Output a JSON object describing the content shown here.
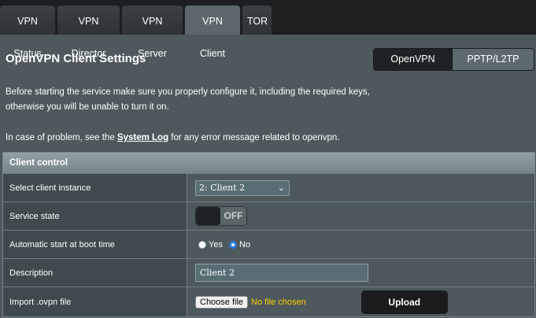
{
  "tabs": [
    {
      "label": "VPN Status"
    },
    {
      "label": "VPN Director"
    },
    {
      "label": "VPN Server"
    },
    {
      "label": "VPN Client",
      "active": true
    },
    {
      "label": "TOR"
    }
  ],
  "header": {
    "title": "OpenVPN Client Settings",
    "mode_options": [
      "OpenVPN",
      "PPTP/L2TP"
    ],
    "mode_selected": "OpenVPN"
  },
  "notes": {
    "line1": "Before starting the service make sure you properly configure it, including the required keys,",
    "line2": "otherwise you will be unable to turn it on.",
    "problem_prefix": "In case of problem, see the ",
    "system_log_link": "System Log",
    "problem_suffix": " for any error message related to openvpn."
  },
  "client_control": {
    "section_title": "Client control",
    "rows": {
      "instance": {
        "label": "Select client instance",
        "value": "2: Client 2"
      },
      "service_state": {
        "label": "Service state",
        "toggle": "OFF"
      },
      "autostart": {
        "label": "Automatic start at boot time",
        "yes": "Yes",
        "no": "No",
        "selected": "No"
      },
      "description": {
        "label": "Description",
        "value": "Client 2"
      },
      "import": {
        "label": "Import .ovpn file",
        "choose_button": "Choose file",
        "file_status": "No file chosen",
        "upload_button": "Upload"
      }
    }
  },
  "colors": {
    "background": "#4d595d",
    "topbar": "#1c1e20",
    "active_tab": "#5b676b",
    "file_status": "#ffcc00",
    "radio_selected": "#2d7be5"
  }
}
